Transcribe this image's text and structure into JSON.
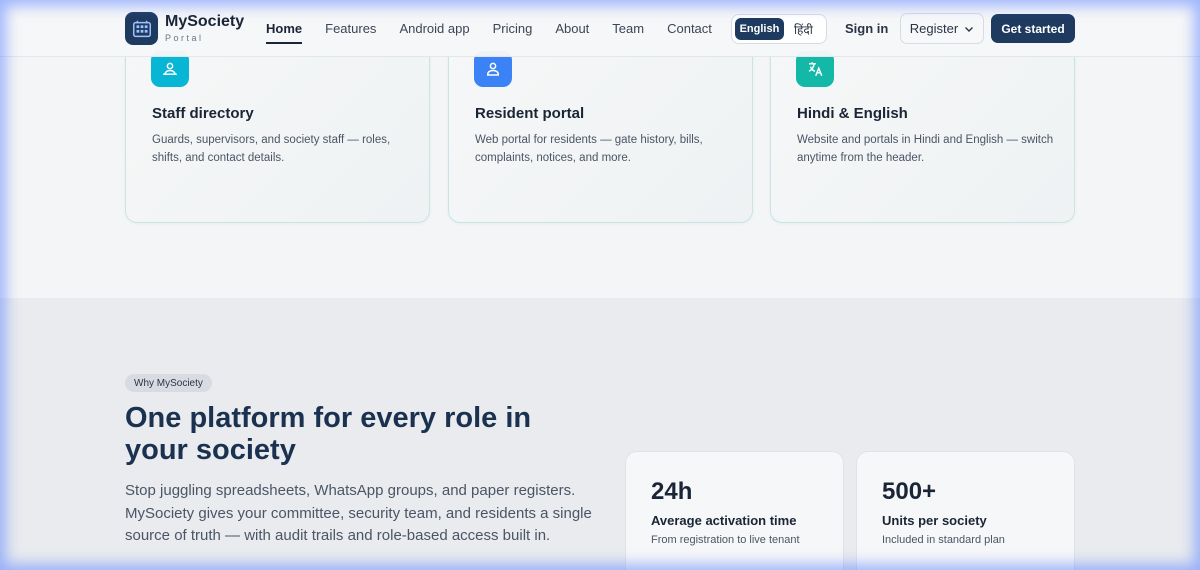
{
  "brand": {
    "name": "MySociety",
    "sub": "Portal"
  },
  "nav": {
    "items": [
      "Home",
      "Features",
      "Android app",
      "Pricing",
      "About",
      "Team",
      "Contact"
    ],
    "active": "Home"
  },
  "lang": {
    "en": "English",
    "hi": "हिंदी"
  },
  "header_actions": {
    "signin": "Sign in",
    "register": "Register",
    "get_started": "Get started"
  },
  "features": [
    {
      "title": "Staff directory",
      "desc": "Guards, supervisors, and society staff — roles, shifts, and contact details.",
      "icon": "staff-icon",
      "color": "#06b6d4"
    },
    {
      "title": "Resident portal",
      "desc": "Web portal for residents — gate history, bills, complaints, notices, and more.",
      "icon": "user-icon",
      "color": "#3b82f6"
    },
    {
      "title": "Hindi & English",
      "desc": "Website and portals in Hindi and English — switch anytime from the header.",
      "icon": "translate-icon",
      "color": "#14b8a6"
    }
  ],
  "why": {
    "badge": "Why MySociety",
    "headline": "One platform for every role in your society",
    "lead": "Stop juggling spreadsheets, WhatsApp groups, and paper registers. MySociety gives your committee, security team, and residents a single source of truth — with audit trails and role-based access built in."
  },
  "stats": [
    {
      "num": "24h",
      "label": "Average activation time",
      "sub": "From registration to live tenant"
    },
    {
      "num": "500+",
      "label": "Units per society",
      "sub": "Included in standard plan"
    }
  ],
  "colors": {
    "primary": "#1e3a5f",
    "card_border": "#c7e4e6"
  }
}
